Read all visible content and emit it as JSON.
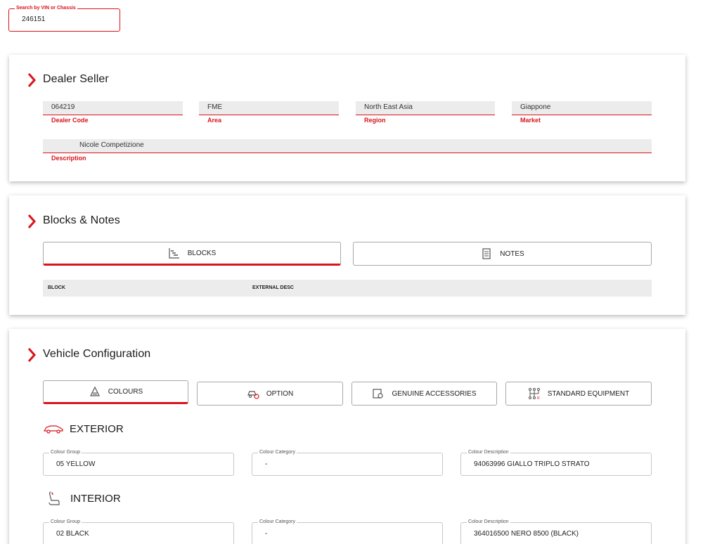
{
  "search": {
    "label": "Search by VIN or Chassis",
    "value": "246151"
  },
  "dealer_seller": {
    "title": "Dealer Seller",
    "fields": [
      {
        "label": "Dealer Code",
        "value": "064219"
      },
      {
        "label": "Area",
        "value": "FME"
      },
      {
        "label": "Region",
        "value": "North East Asia"
      },
      {
        "label": "Market",
        "value": "Giappone"
      }
    ],
    "description": {
      "label": "Description",
      "value": "Nicole Competizione"
    }
  },
  "blocks_notes": {
    "title": "Blocks & Notes",
    "tabs": [
      {
        "label": "BLOCKS",
        "icon": "list-stairs-icon",
        "active": true
      },
      {
        "label": "NOTES",
        "icon": "document-icon",
        "active": false
      }
    ],
    "columns": [
      "BLOCK",
      "EXTERNAL DESC"
    ]
  },
  "vehicle_configuration": {
    "title": "Vehicle Configuration",
    "tabs": [
      {
        "label": "COLOURS",
        "icon": "paint-roller-icon",
        "active": true
      },
      {
        "label": "OPTION",
        "icon": "car-gear-icon",
        "active": false
      },
      {
        "label": "GENUINE ACCESSORIES",
        "icon": "accessories-icon",
        "active": false
      },
      {
        "label": "STANDARD EQUIPMENT",
        "icon": "gearshift-icon",
        "active": false
      }
    ],
    "exterior": {
      "title": "EXTERIOR",
      "icon": "car-icon",
      "fields": [
        {
          "label": "Colour Group",
          "value": "05 YELLOW"
        },
        {
          "label": "Colour Category",
          "value": "-"
        },
        {
          "label": "Colour Description",
          "value": "94063996 GIALLO TRIPLO STRATO"
        }
      ]
    },
    "interior": {
      "title": "INTERIOR",
      "icon": "seat-icon",
      "fields": [
        {
          "label": "Colour Group",
          "value": "02 BLACK"
        },
        {
          "label": "Colour Category",
          "value": "-"
        },
        {
          "label": "Colour Description",
          "value": "364016500 NERO 8500 (BLACK)"
        }
      ]
    }
  },
  "colors": {
    "accent": "#d9141b",
    "field_bg": "#ececec"
  }
}
